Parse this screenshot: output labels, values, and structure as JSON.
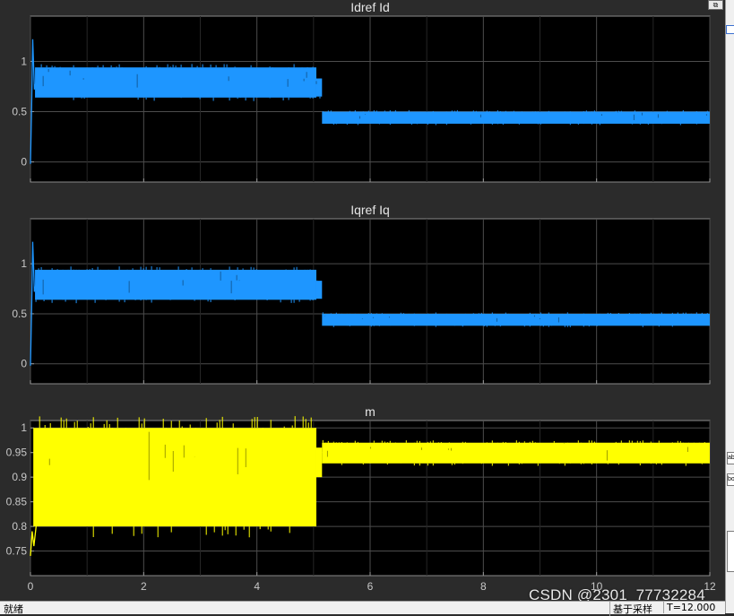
{
  "window": {
    "status_left": "就绪",
    "status_mid": "基于采样",
    "status_right": "T=12.000",
    "watermark": "CSDN @2301_77732284",
    "restore_icon": "restore-window-icon",
    "side_label_1": "ab",
    "side_label_2": "bo"
  },
  "colors": {
    "background": "#2b2b2b",
    "axes_bg": "#000000",
    "grid": "#4d4d4d",
    "axis_text": "#c8c8c8",
    "blue": "#1e96ff",
    "yellow": "#ffff00"
  },
  "chart_data": [
    {
      "type": "line",
      "title": "Idref  Id",
      "xlim": [
        0,
        12
      ],
      "ylim": [
        -0.2,
        1.45
      ],
      "xticks": [
        0,
        2,
        4,
        6,
        8,
        10,
        12
      ],
      "yticks": [
        0,
        0.5,
        1
      ],
      "ytick_labels": [
        "0",
        "0.5",
        "1"
      ],
      "xtick_labels": [],
      "grid": true,
      "series": [
        {
          "color": "#1e96ff",
          "band": [
            {
              "x": [
                0.08,
                5.05
              ],
              "lo": 0.64,
              "hi": 0.94
            },
            {
              "x": [
                5.05,
                5.15
              ],
              "lo": 0.65,
              "hi": 0.83
            },
            {
              "x": [
                5.15,
                12.0
              ],
              "lo": 0.38,
              "hi": 0.5
            }
          ],
          "transient": [
            [
              0,
              -0.02
            ],
            [
              0.02,
              0.55
            ],
            [
              0.04,
              1.22
            ],
            [
              0.07,
              0.72
            ],
            [
              0.12,
              0.86
            ]
          ]
        }
      ]
    },
    {
      "type": "line",
      "title": "Iqref  Iq",
      "xlim": [
        0,
        12
      ],
      "ylim": [
        -0.2,
        1.45
      ],
      "xticks": [
        0,
        2,
        4,
        6,
        8,
        10,
        12
      ],
      "yticks": [
        0,
        0.5,
        1
      ],
      "ytick_labels": [
        "0",
        "0.5",
        "1"
      ],
      "xtick_labels": [],
      "grid": true,
      "series": [
        {
          "color": "#1e96ff",
          "band": [
            {
              "x": [
                0.08,
                5.05
              ],
              "lo": 0.64,
              "hi": 0.94
            },
            {
              "x": [
                5.05,
                5.15
              ],
              "lo": 0.65,
              "hi": 0.83
            },
            {
              "x": [
                5.15,
                12.0
              ],
              "lo": 0.38,
              "hi": 0.5
            }
          ],
          "transient": [
            [
              0,
              -0.02
            ],
            [
              0.02,
              0.55
            ],
            [
              0.04,
              1.22
            ],
            [
              0.07,
              0.72
            ],
            [
              0.12,
              0.86
            ]
          ]
        }
      ]
    },
    {
      "type": "line",
      "title": "m",
      "xlim": [
        0,
        12
      ],
      "ylim": [
        0.7,
        1.015
      ],
      "xticks": [
        0,
        2,
        4,
        6,
        8,
        10,
        12
      ],
      "yticks": [
        0.75,
        0.8,
        0.85,
        0.9,
        0.95,
        1
      ],
      "ytick_labels": [
        "0.75",
        "0.8",
        "0.85",
        "0.9",
        "0.95",
        "1"
      ],
      "xtick_labels": [
        "0",
        "2",
        "4",
        "6",
        "8",
        "10",
        "12"
      ],
      "grid": true,
      "series": [
        {
          "color": "#ffff00",
          "band": [
            {
              "x": [
                0.05,
                5.05
              ],
              "lo": 0.8,
              "hi": 1.0
            },
            {
              "x": [
                5.05,
                5.15
              ],
              "lo": 0.9,
              "hi": 0.96
            },
            {
              "x": [
                5.15,
                12.0
              ],
              "lo": 0.928,
              "hi": 0.97
            }
          ],
          "transient": [
            [
              0,
              0.74
            ],
            [
              0.03,
              0.79
            ],
            [
              0.06,
              0.76
            ],
            [
              0.1,
              0.8
            ]
          ]
        }
      ]
    }
  ]
}
